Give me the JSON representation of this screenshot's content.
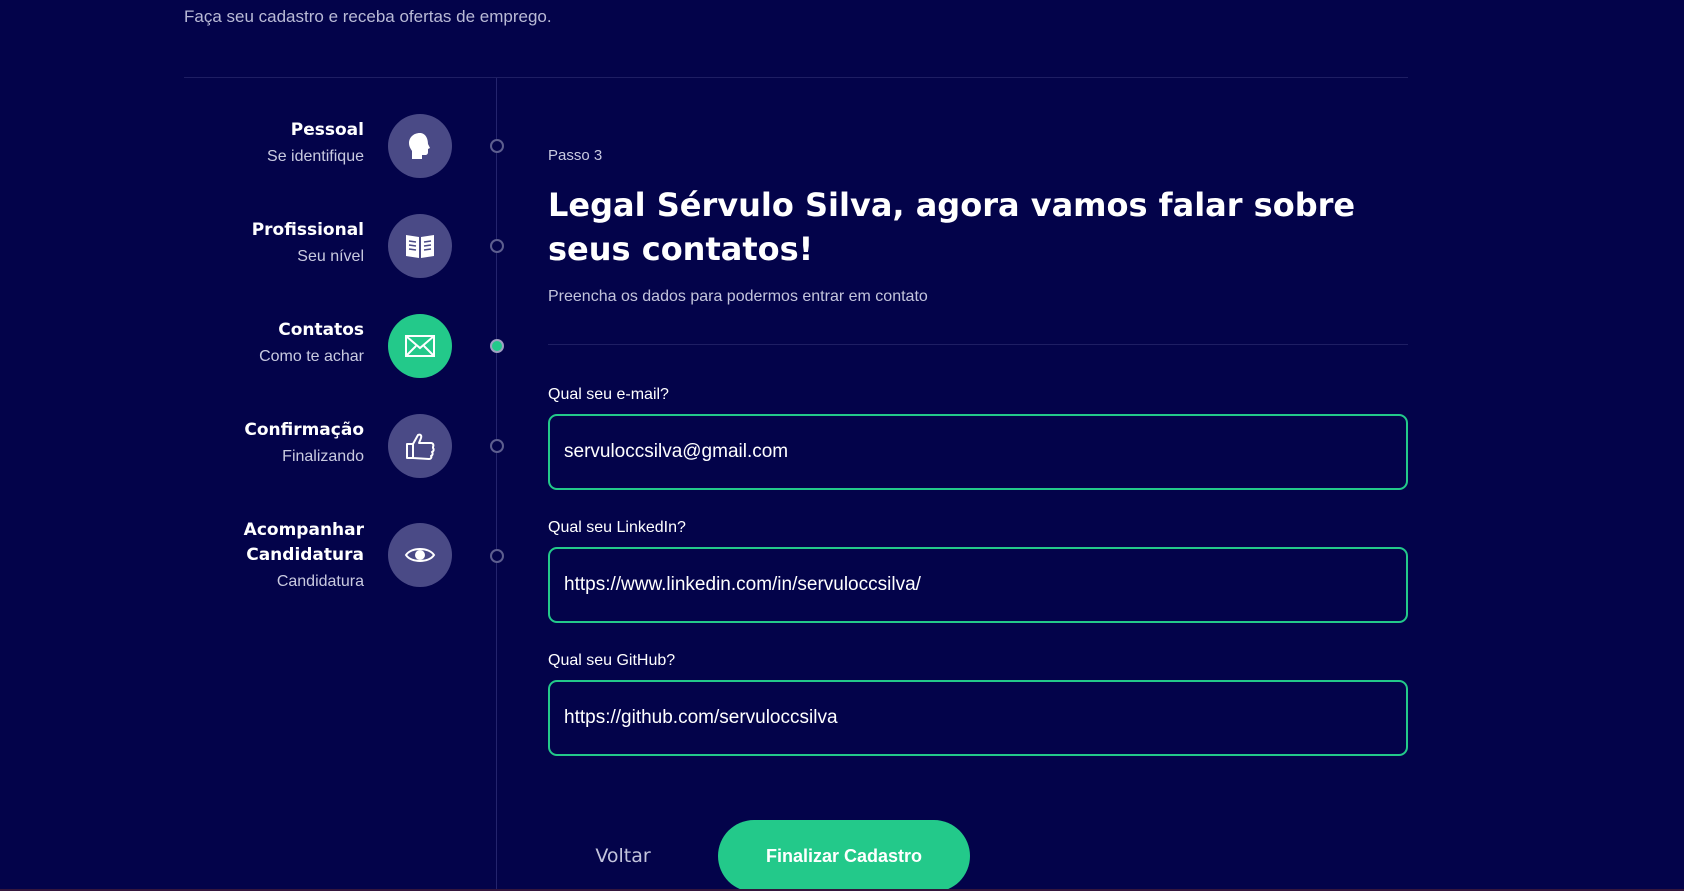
{
  "header": {
    "subtitle": "Faça seu cadastro e receba ofertas de emprego."
  },
  "steps": [
    {
      "title": "Pessoal",
      "subtitle": "Se identifique",
      "icon": "head-icon",
      "active": false
    },
    {
      "title": "Profissional",
      "subtitle": "Seu nível",
      "icon": "book-icon",
      "active": false
    },
    {
      "title": "Contatos",
      "subtitle": "Como te achar",
      "icon": "envelope-icon",
      "active": true
    },
    {
      "title": "Confirmação",
      "subtitle": "Finalizando",
      "icon": "thumbs-up-icon",
      "active": false
    },
    {
      "title_line1": "Acompanhar",
      "title_line2": "Candidatura",
      "subtitle": "Candidatura",
      "icon": "eye-icon",
      "active": false
    }
  ],
  "form": {
    "step_label": "Passo 3",
    "heading": "Legal Sérvulo Silva, agora vamos falar sobre seus contatos!",
    "intro": "Preencha os dados para podermos entrar em contato",
    "email": {
      "label": "Qual seu e-mail?",
      "value": "servuloccsilva@gmail.com"
    },
    "linkedin": {
      "label": "Qual seu LinkedIn?",
      "value": "https://www.linkedin.com/in/servuloccsilva/"
    },
    "github": {
      "label": "Qual seu GitHub?",
      "value": "https://github.com/servuloccsilva"
    }
  },
  "actions": {
    "back_label": "Voltar",
    "finish_label": "Finalizar Cadastro"
  },
  "colors": {
    "background": "#03034a",
    "accent": "#23c98a",
    "inactive_icon": "#4a4a86"
  }
}
